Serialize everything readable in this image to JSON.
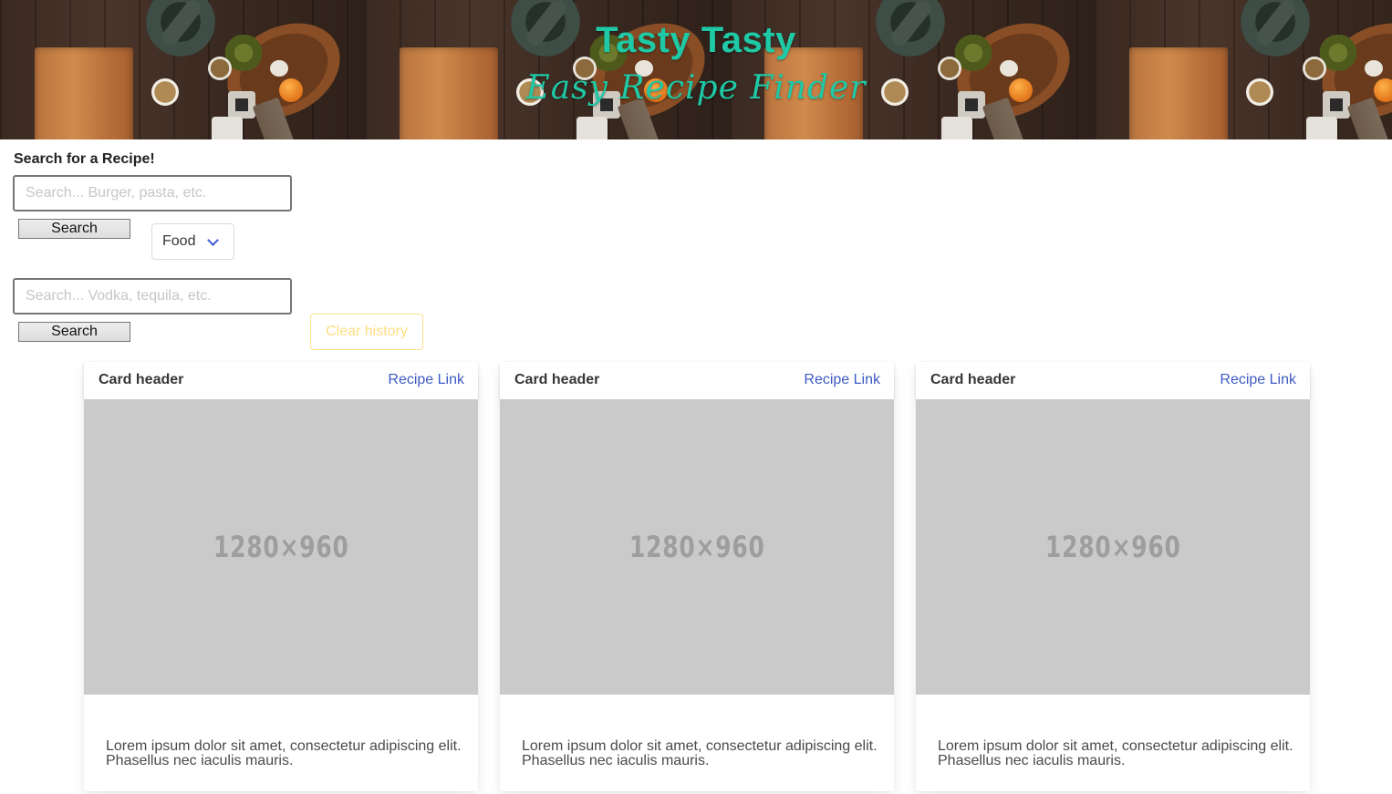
{
  "hero": {
    "title": "Tasty Tasty",
    "subtitle": "Easy Recipe Finder",
    "title_color": "#1fc9a6"
  },
  "search": {
    "label": "Search for a Recipe!",
    "food_placeholder": "Search... Burger, pasta, etc.",
    "food_value": "",
    "food_button": "Search",
    "category_selected": "Food",
    "drink_placeholder": "Search... Vodka, tequila, etc.",
    "drink_value": "",
    "drink_button": "Search",
    "clear_button": "Clear history",
    "clear_color": "#ffdd80"
  },
  "cards": [
    {
      "header": "Card header",
      "link": "Recipe Link",
      "image_placeholder": "1280×960",
      "body": "Lorem ipsum dolor sit amet, consectetur adipiscing elit. Phasellus nec iaculis mauris."
    },
    {
      "header": "Card header",
      "link": "Recipe Link",
      "image_placeholder": "1280×960",
      "body": "Lorem ipsum dolor sit amet, consectetur adipiscing elit. Phasellus nec iaculis mauris."
    },
    {
      "header": "Card header",
      "link": "Recipe Link",
      "image_placeholder": "1280×960",
      "body": "Lorem ipsum dolor sit amet, consectetur adipiscing elit. Phasellus nec iaculis mauris."
    }
  ],
  "icons": {
    "select_chevron": "chevron-down-icon"
  },
  "colors": {
    "link": "#3e5bc4",
    "image_placeholder_bg": "#cacaca"
  }
}
